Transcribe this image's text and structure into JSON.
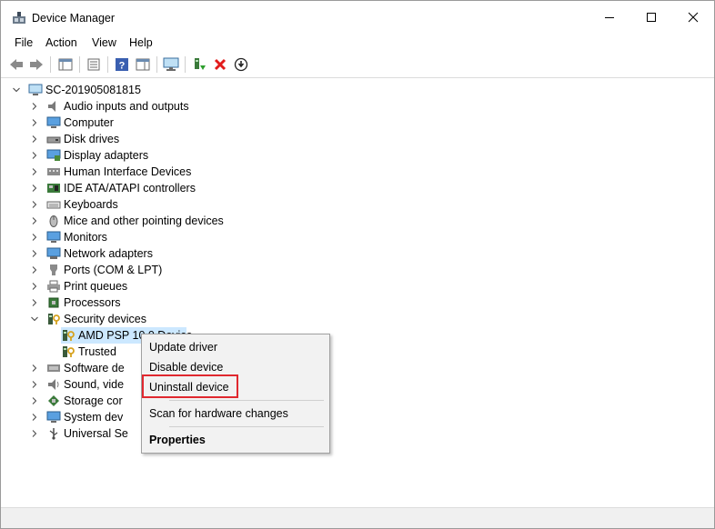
{
  "window": {
    "title": "Device Manager",
    "minimize_icon": "minimize-icon",
    "maximize_icon": "maximize-icon",
    "close_icon": "close-icon"
  },
  "menubar": {
    "items": [
      {
        "label": "File"
      },
      {
        "label": "Action"
      },
      {
        "label": "View"
      },
      {
        "label": "Help"
      }
    ]
  },
  "toolbar": {
    "buttons": [
      "back-icon",
      "forward-icon",
      "show-hide-console-tree-icon",
      "properties-icon",
      "help-icon",
      "action-pane-icon",
      "scan-hardware-icon",
      "update-driver-icon",
      "uninstall-icon",
      "download-icon"
    ],
    "accent_red": "#e21b1b"
  },
  "tree": {
    "root": "SC-201905081815",
    "categories": [
      {
        "label": "Audio inputs and outputs"
      },
      {
        "label": "Computer"
      },
      {
        "label": "Disk drives"
      },
      {
        "label": "Display adapters"
      },
      {
        "label": "Human Interface Devices"
      },
      {
        "label": "IDE ATA/ATAPI controllers"
      },
      {
        "label": "Keyboards"
      },
      {
        "label": "Mice and other pointing devices"
      },
      {
        "label": "Monitors"
      },
      {
        "label": "Network adapters"
      },
      {
        "label": "Ports (COM & LPT)"
      },
      {
        "label": "Print queues"
      },
      {
        "label": "Processors"
      },
      {
        "label": "Security devices"
      },
      {
        "label": "AMD PSP 10.0 Device"
      },
      {
        "label": "Trusted"
      },
      {
        "label": "Software de"
      },
      {
        "label": "Sound, vide"
      },
      {
        "label": "Storage cor"
      },
      {
        "label": "System dev"
      },
      {
        "label": "Universal Se"
      }
    ]
  },
  "context_menu": {
    "items": [
      {
        "label": "Update driver"
      },
      {
        "label": "Disable device"
      },
      {
        "label": "Uninstall device"
      },
      {
        "label": "Scan for hardware changes"
      },
      {
        "label": "Properties"
      }
    ],
    "highlight_color": "#e0282f"
  }
}
